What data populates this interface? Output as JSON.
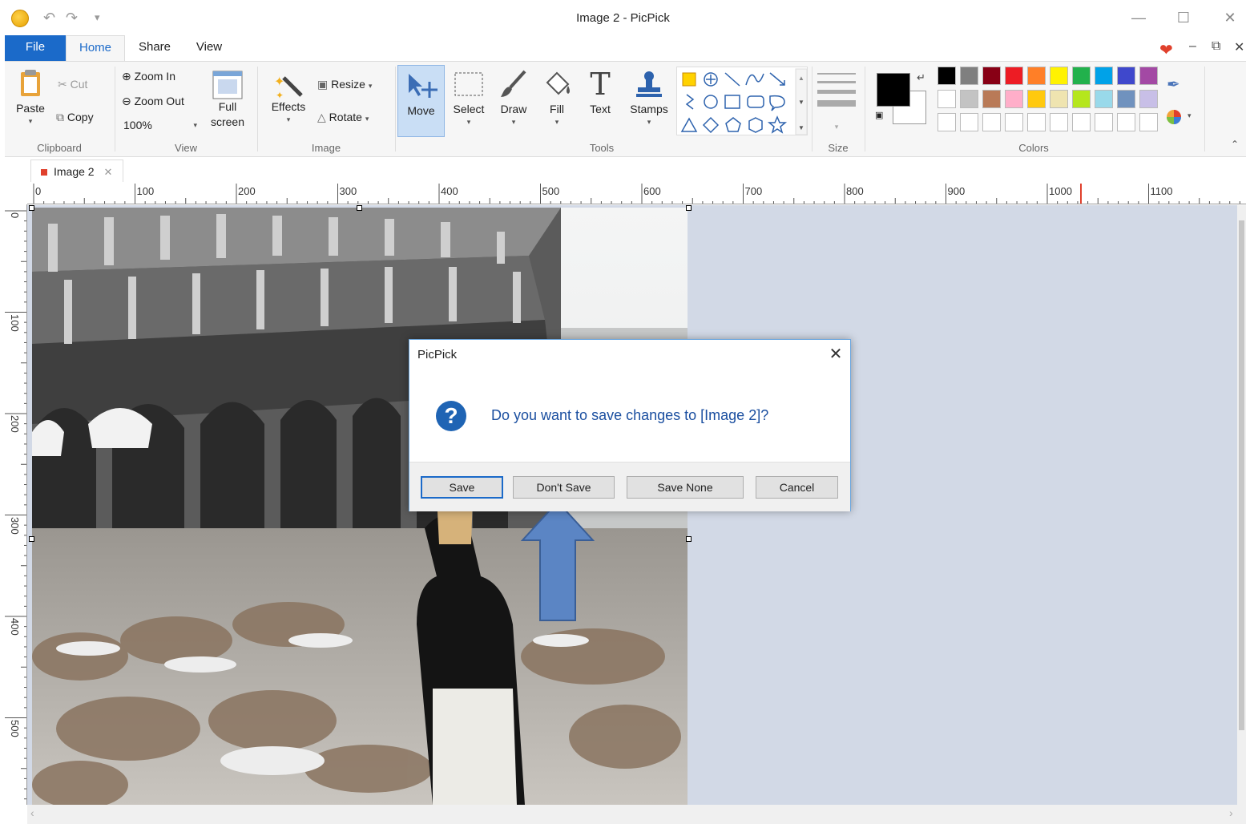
{
  "window": {
    "title": "Image 2 - PicPick"
  },
  "menu": {
    "tabs": [
      "File",
      "Home",
      "Share",
      "View"
    ]
  },
  "ribbon": {
    "clipboard": {
      "label": "Clipboard",
      "paste": "Paste",
      "cut": "Cut",
      "copy": "Copy"
    },
    "view": {
      "label": "View",
      "zoom_in": "Zoom In",
      "zoom_out": "Zoom Out",
      "zoom_level": "100%",
      "full_screen_1": "Full",
      "full_screen_2": "screen"
    },
    "image": {
      "label": "Image",
      "effects": "Effects",
      "resize": "Resize",
      "rotate": "Rotate"
    },
    "tools": {
      "label": "Tools",
      "move": "Move",
      "select": "Select",
      "draw": "Draw",
      "fill": "Fill",
      "text": "Text",
      "stamps": "Stamps"
    },
    "size": {
      "label": "Size"
    },
    "colors": {
      "label": "Colors",
      "foreground": "#000000",
      "background": "#ffffff",
      "palette_row1": [
        "#000000",
        "#7f7f7f",
        "#880015",
        "#ed1c24",
        "#ff7f27",
        "#fff200",
        "#22b14c",
        "#00a2e8",
        "#3f48cc",
        "#a349a4"
      ],
      "palette_row2": [
        "#ffffff",
        "#c3c3c3",
        "#b97a57",
        "#ffaec9",
        "#ffc90e",
        "#efe4b0",
        "#b5e61d",
        "#99d9ea",
        "#7092be",
        "#c8bfe7"
      ],
      "palette_row3": [
        "#ffffff",
        "#ffffff",
        "#ffffff",
        "#ffffff",
        "#ffffff",
        "#ffffff",
        "#ffffff",
        "#ffffff",
        "#ffffff",
        "#ffffff"
      ]
    }
  },
  "document": {
    "tab": "Image 2"
  },
  "ruler": {
    "h": [
      "0",
      "100",
      "200",
      "300",
      "400",
      "500",
      "600",
      "700",
      "800",
      "900",
      "1000",
      "1100"
    ],
    "v": [
      "0",
      "100",
      "200",
      "300",
      "400",
      "500"
    ]
  },
  "dialog": {
    "title": "PicPick",
    "message": "Do you want to save changes to [Image 2]?",
    "buttons": {
      "save": "Save",
      "dont_save": "Don't Save",
      "save_none": "Save None",
      "cancel": "Cancel"
    }
  }
}
